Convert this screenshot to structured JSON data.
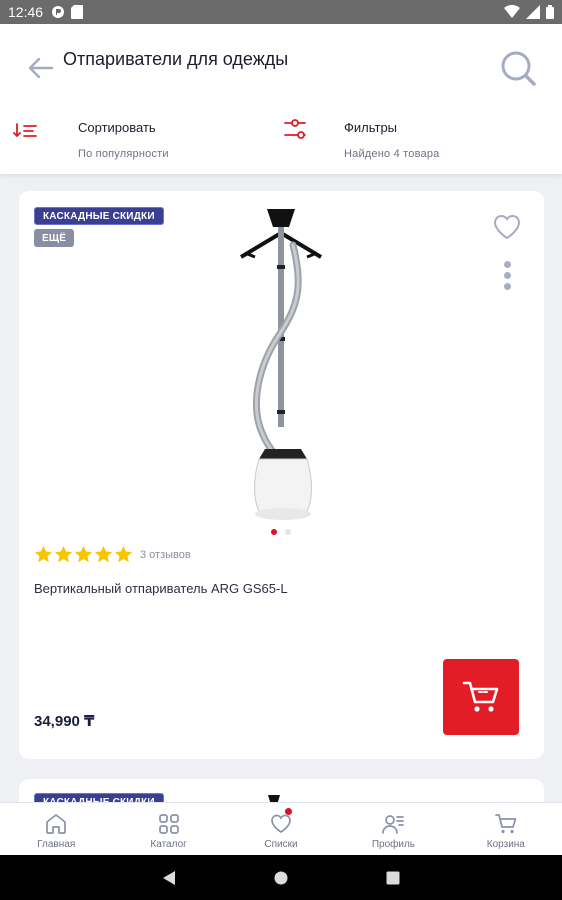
{
  "status_bar": {
    "time": "12:46",
    "left_icons": [
      "app-notification-icon",
      "sd-card-icon"
    ],
    "right_icons": [
      "wifi-icon",
      "signal-icon",
      "battery-icon"
    ]
  },
  "header": {
    "title": "Отпариватели для одежды",
    "back_icon": "arrow-left-icon",
    "search_icon": "search-icon"
  },
  "toolbar": {
    "sort": {
      "label": "Сортировать",
      "value": "По популярности",
      "icon": "sort-icon"
    },
    "filter": {
      "label": "Фильтры",
      "value": "Найдено 4 товара",
      "icon": "filter-sliders-icon"
    }
  },
  "products": [
    {
      "badges": [
        "КАСКАДНЫЕ СКИДКИ",
        "ЕЩЁ"
      ],
      "name": "Вертикальный отпариватель ARG GS65-L",
      "rating": 5,
      "reviews": "3 отзывов",
      "price": "34,990 ₸",
      "image_count": 2,
      "active_image": 0
    },
    {
      "badges": [
        "КАСКАДНЫЕ СКИДКИ"
      ]
    }
  ],
  "bottom_nav": [
    {
      "label": "Главная",
      "icon": "home-icon"
    },
    {
      "label": "Каталог",
      "icon": "catalog-grid-icon"
    },
    {
      "label": "Списки",
      "icon": "heart-icon",
      "has_notification": true
    },
    {
      "label": "Профиль",
      "icon": "profile-icon"
    },
    {
      "label": "Корзина",
      "icon": "cart-icon"
    }
  ],
  "colors": {
    "accent_red": "#e21d26",
    "badge_blue": "#3a3f92",
    "badge_grey": "#8a8ea2",
    "star_yellow": "#f7c600",
    "background": "#eef0f4"
  }
}
